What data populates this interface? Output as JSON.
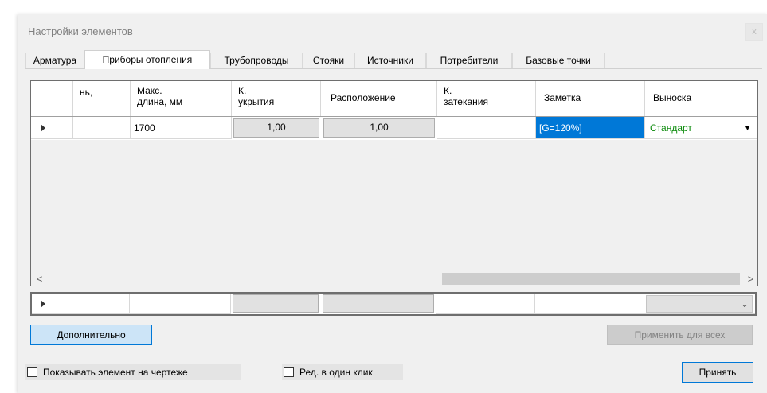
{
  "window": {
    "title": "Настройки элементов",
    "close_glyph": "x"
  },
  "tabs": [
    {
      "label": "Арматура"
    },
    {
      "label": "Приборы отопления",
      "active": true
    },
    {
      "label": "Трубопроводы"
    },
    {
      "label": "Стояки"
    },
    {
      "label": "Источники"
    },
    {
      "label": "Потребители"
    },
    {
      "label": "Базовые точки"
    }
  ],
  "grid": {
    "headers": {
      "col1": "нь,",
      "col2a": "Макс.",
      "col2b": "длина, мм",
      "col3a": "К.",
      "col3b": "укрытия",
      "col4": "Расположение",
      "col5a": "К.",
      "col5b": "затекания",
      "col6": "Заметка",
      "col7": "Выноска"
    },
    "row": {
      "max_length": "1700",
      "k_cover": "1,00",
      "location": "1,00",
      "k_leak": "",
      "note": "[G=120%]",
      "callout": "Стандарт"
    },
    "scroll_left": "<",
    "scroll_right": ">"
  },
  "buttons": {
    "more": "Дополнительно",
    "apply_all": "Применить для всех",
    "accept": "Принять"
  },
  "checkboxes": {
    "show_on_drawing": "Показывать элемент на чертеже",
    "one_click_edit": "Ред. в один клик"
  },
  "colors": {
    "selection": "#0078d7",
    "green_text": "#0a8a0a",
    "accent_button": "#cce4f7"
  }
}
